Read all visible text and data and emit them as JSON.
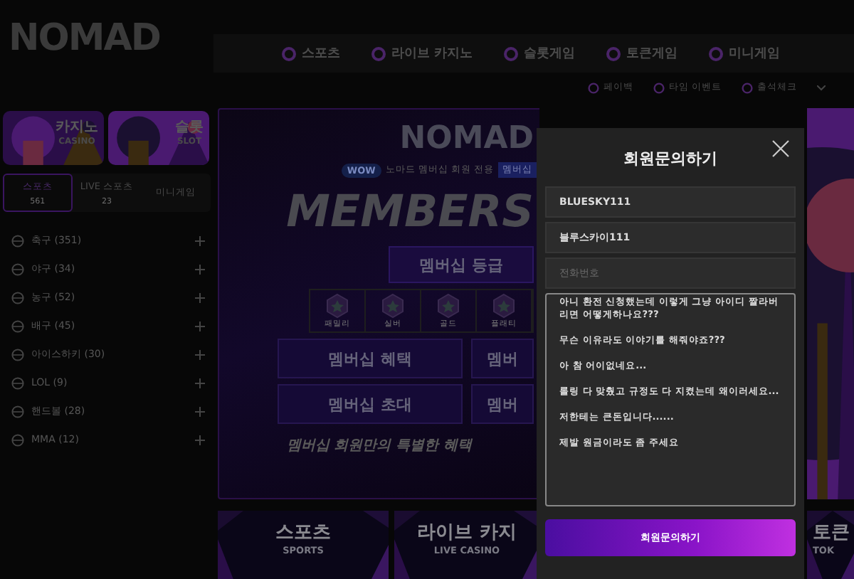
{
  "header": {
    "logo": "NOMAD",
    "nav": [
      {
        "label": "스포츠"
      },
      {
        "label": "라이브 카지노"
      },
      {
        "label": "슬롯게임"
      },
      {
        "label": "토큰게임"
      },
      {
        "label": "미니게임"
      }
    ],
    "sub_links": [
      {
        "label": "페이백"
      },
      {
        "label": "타임 이벤트"
      },
      {
        "label": "출석체크"
      }
    ]
  },
  "sidebar": {
    "thumbnails": [
      {
        "title": "카지노",
        "subtitle": "CASINO"
      },
      {
        "title": "슬롯",
        "subtitle": "SLOT"
      }
    ],
    "tabs": [
      {
        "label": "스포츠",
        "count": "561",
        "selected": true
      },
      {
        "label": "LIVE 스포츠",
        "count": "23",
        "selected": false
      },
      {
        "label": "미니게임",
        "selected": false
      }
    ],
    "sports": [
      {
        "label": "축구 (351)"
      },
      {
        "label": "야구 (34)"
      },
      {
        "label": "농구 (52)"
      },
      {
        "label": "배구 (45)"
      },
      {
        "label": "아이스하키 (30)"
      },
      {
        "label": "LOL (9)"
      },
      {
        "label": "핸드볼 (28)"
      },
      {
        "label": "MMA (12)"
      }
    ]
  },
  "banner": {
    "logo": "NOMAD",
    "badge": "WOW",
    "subtitle": "노마드 멤버십 회원 전용",
    "tag": "멤버십",
    "headline": "MEMBERS",
    "grade_button": "멤버십 등급",
    "grades": [
      {
        "label": "패밀리"
      },
      {
        "label": "실버"
      },
      {
        "label": "골드"
      },
      {
        "label": "플래티"
      }
    ],
    "buttons": [
      {
        "label": "멤버십 혜택"
      },
      {
        "label": "멤버"
      },
      {
        "label": "멤버십 초대"
      },
      {
        "label": "멤버"
      }
    ],
    "tagline": "멤버십 회원만의 특별한 혜택"
  },
  "game_cards": [
    {
      "title": "스포츠",
      "subtitle": "SPORTS"
    },
    {
      "title": "라이브 카지",
      "subtitle": "LIVE CASINO"
    },
    {
      "title": "토큰",
      "subtitle": "TOK"
    }
  ],
  "modal": {
    "title": "회원문의하기",
    "fields": [
      {
        "value": "BLUESKY111"
      },
      {
        "value": "블루스카이111"
      },
      {
        "placeholder": "전화번호"
      }
    ],
    "message": "아니 환전 신청했는데 이렇게 그냥 아이디 짤라버리면 어떻게하나요???\n\n무슨 이유라도 이야기를 해줘야죠???\n\n아 참 어이없네요...\n\n롤링 다 맞췄고 규정도 다 지켰는데 왜이러세요...\n\n저한테는 큰돈입니다......\n\n제발 원금이라도 좀 주세요",
    "submit": "회원문의하기"
  }
}
